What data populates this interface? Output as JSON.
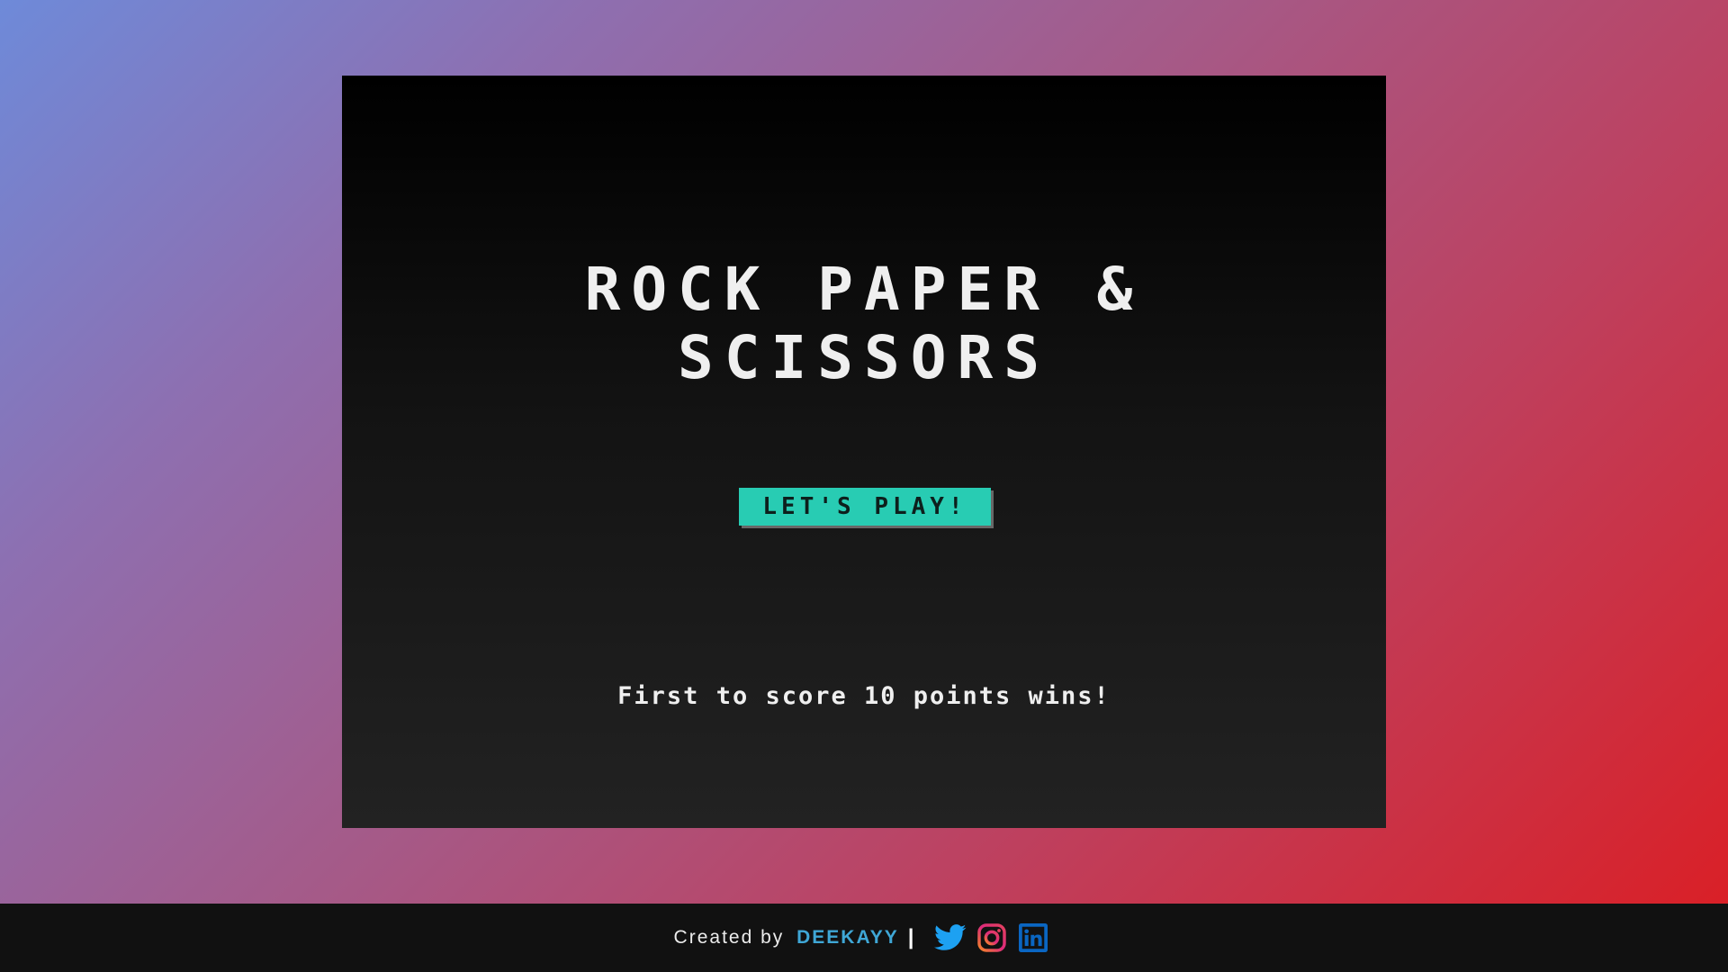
{
  "game": {
    "title_line1": "ROCK PAPER &",
    "title_line2": "SCISSORS",
    "play_button_label": "LET'S PLAY!",
    "rules_text": "First to score 10 points wins!"
  },
  "footer": {
    "credit_prefix": "Created by",
    "author_name": "DEEKAYY",
    "separator": "|",
    "social_icons": [
      "twitter-icon",
      "instagram-icon",
      "linkedin-icon"
    ]
  },
  "colors": {
    "play_button": "#28ccb3",
    "author_link": "#3fa7d6",
    "twitter": "#1da1f2",
    "instagram": "#e4405f",
    "linkedin": "#0a66c2",
    "panel": "#111111",
    "footer": "#111111"
  }
}
